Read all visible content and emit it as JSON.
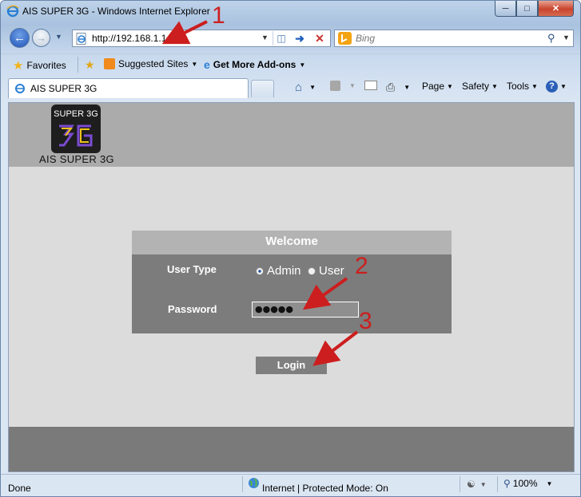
{
  "window": {
    "title": "AIS SUPER 3G - Windows Internet Explorer",
    "icon": "ie-icon"
  },
  "nav": {
    "address": "http://192.168.1.1",
    "search_placeholder": "Bing"
  },
  "favorites_bar": {
    "favorites_label": "Favorites",
    "suggested_sites_label": "Suggested Sites",
    "addons_label": "Get More Add-ons"
  },
  "tab": {
    "title": "AIS SUPER 3G"
  },
  "command_bar": {
    "page_label": "Page",
    "safety_label": "Safety",
    "tools_label": "Tools"
  },
  "page": {
    "logo_top": "SUPER 3G",
    "logo_caption": "AIS SUPER 3G",
    "panel_title": "Welcome",
    "user_type_label": "User Type",
    "admin_label": "Admin",
    "user_label": "User",
    "selected_user_type": "Admin",
    "password_label": "Password",
    "password_value": "●●●●●",
    "login_label": "Login"
  },
  "status_bar": {
    "status": "Done",
    "zone": "Internet | Protected Mode: On",
    "zoom": "100%"
  },
  "annotations": {
    "step1": "1",
    "step2": "2",
    "step3": "3"
  },
  "colors": {
    "annotation_red": "#cc1e1e",
    "panel_gray": "#7c7c7c"
  }
}
